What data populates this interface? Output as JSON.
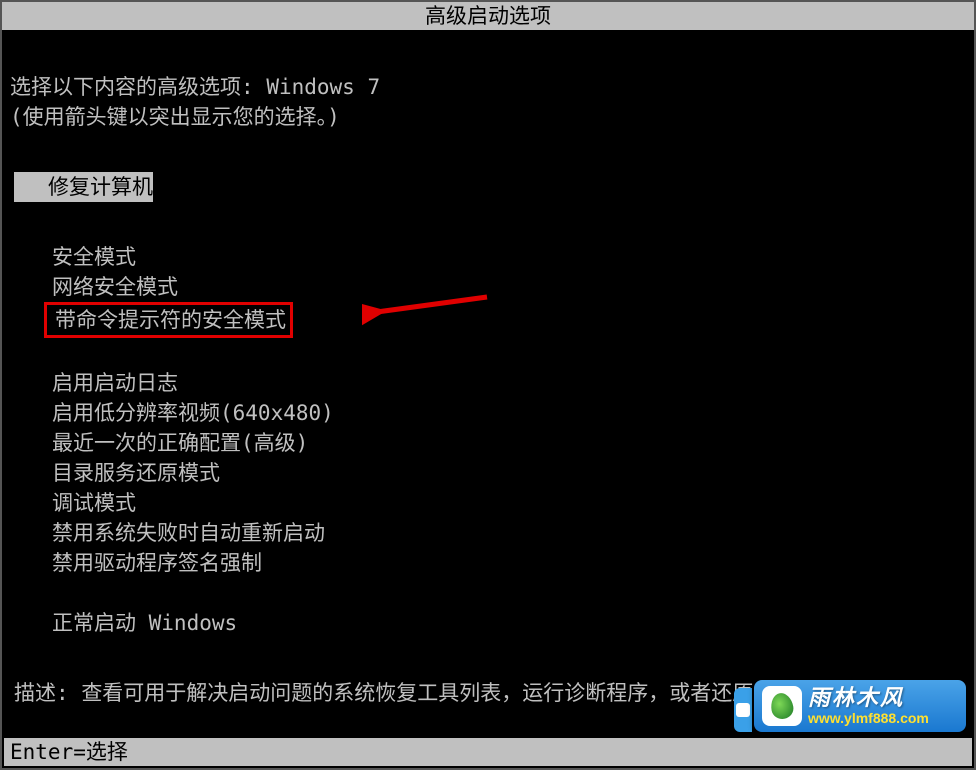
{
  "title": "高级启动选项",
  "intro": {
    "line1_prefix": "选择以下内容的高级选项:",
    "os_name": "Windows 7",
    "hint": "(使用箭头键以突出显示您的选择。)"
  },
  "repair_option": "修复计算机",
  "options_group1": [
    "安全模式",
    "网络安全模式",
    "带命令提示符的安全模式"
  ],
  "options_group2": [
    "启用启动日志",
    "启用低分辨率视频(640x480)",
    "最近一次的正确配置(高级)",
    "目录服务还原模式",
    "调试模式",
    "禁用系统失败时自动重新启动",
    "禁用驱动程序签名强制"
  ],
  "options_group3": [
    "正常启动 Windows"
  ],
  "highlighted_option_index": 2,
  "description": {
    "label": "描述:",
    "text": "查看可用于解决启动问题的系统恢复工具列表，运行诊断程序，或者还原系统。"
  },
  "footer": {
    "enter": "Enter=选择"
  },
  "watermark": {
    "brand": "雨林木风",
    "url": "www.ylmf888.com"
  }
}
